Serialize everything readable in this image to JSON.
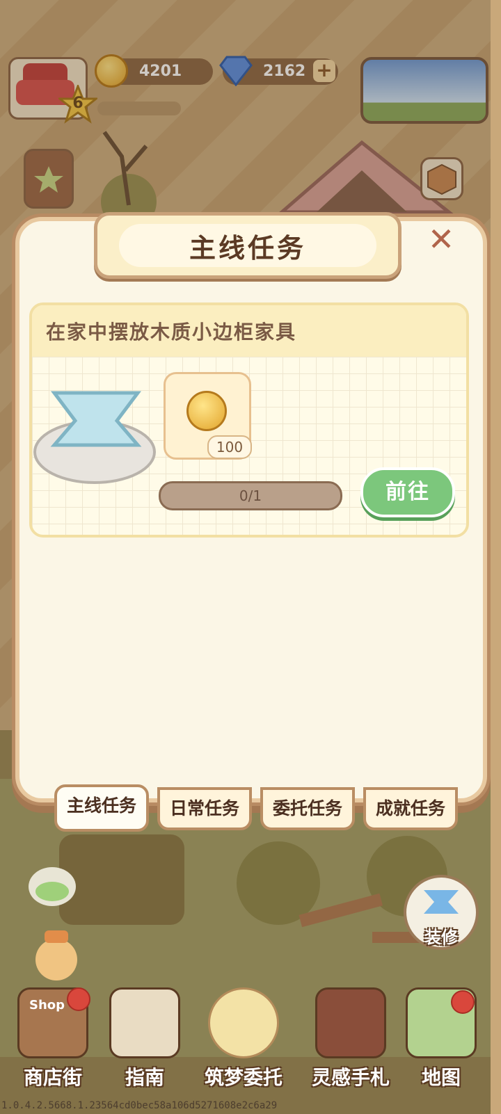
{
  "hud": {
    "level": "6",
    "coins": "4201",
    "gems": "2162",
    "add_symbol": "+"
  },
  "panel": {
    "title": "主线任务",
    "close_symbol": "✕",
    "task": {
      "description": "在家中摆放木质小边柜家具",
      "reward_count": "100",
      "progress_text": "0/1",
      "progress_fraction": 0,
      "go_button": "前往"
    }
  },
  "tabs": [
    {
      "label": "主线任务",
      "active": true
    },
    {
      "label": "日常任务",
      "active": false
    },
    {
      "label": "委托任务",
      "active": false
    },
    {
      "label": "成就任务",
      "active": false
    }
  ],
  "side": {
    "decorate_label": "装修"
  },
  "bottom_nav": [
    {
      "label": "商店街",
      "badge": true
    },
    {
      "label": "指南",
      "badge": false
    },
    {
      "label": "筑梦委托",
      "badge": false
    },
    {
      "label": "灵感手札",
      "badge": false
    },
    {
      "label": "地图",
      "badge": true
    }
  ],
  "shop_sign": "Shop",
  "version": "1.0.4.2.5668.1.23564cd0bec58a106d5271608e2c6a29",
  "colors": {
    "panel_bg": "#fbf6e6",
    "go_button": "#7cc77c",
    "title_text": "#5b3a24",
    "badge_red": "#d9473c"
  }
}
